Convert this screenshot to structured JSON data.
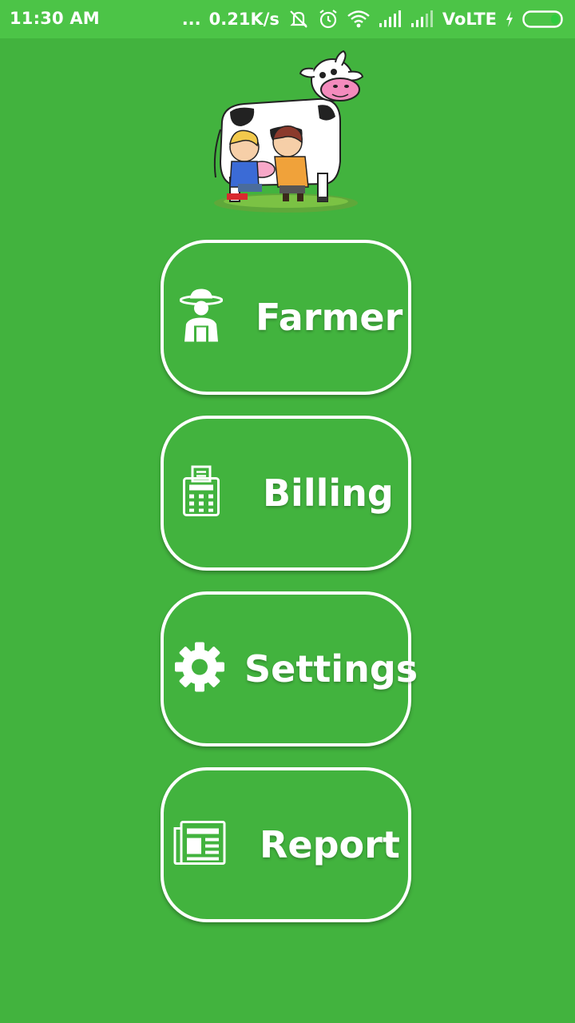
{
  "status_bar": {
    "time": "11:30 AM",
    "dots": "...",
    "net_speed": "0.21K/s",
    "network_type": "VoLTE",
    "icons": [
      "mute-icon",
      "alarm-icon",
      "wifi-icon",
      "signal-icon",
      "signal-icon-2",
      "charging-icon",
      "battery-icon"
    ]
  },
  "hero": {
    "image": "cow-milking-illustration"
  },
  "menu": {
    "items": [
      {
        "label": "Farmer",
        "icon": "farmer-icon"
      },
      {
        "label": "Billing",
        "icon": "billing-icon"
      },
      {
        "label": "Settings",
        "icon": "gear-icon"
      },
      {
        "label": "Report",
        "icon": "newspaper-icon"
      }
    ]
  },
  "colors": {
    "background": "#42b33e",
    "status_bar": "#4cc447",
    "button_border": "#ffffff",
    "text": "#ffffff"
  }
}
